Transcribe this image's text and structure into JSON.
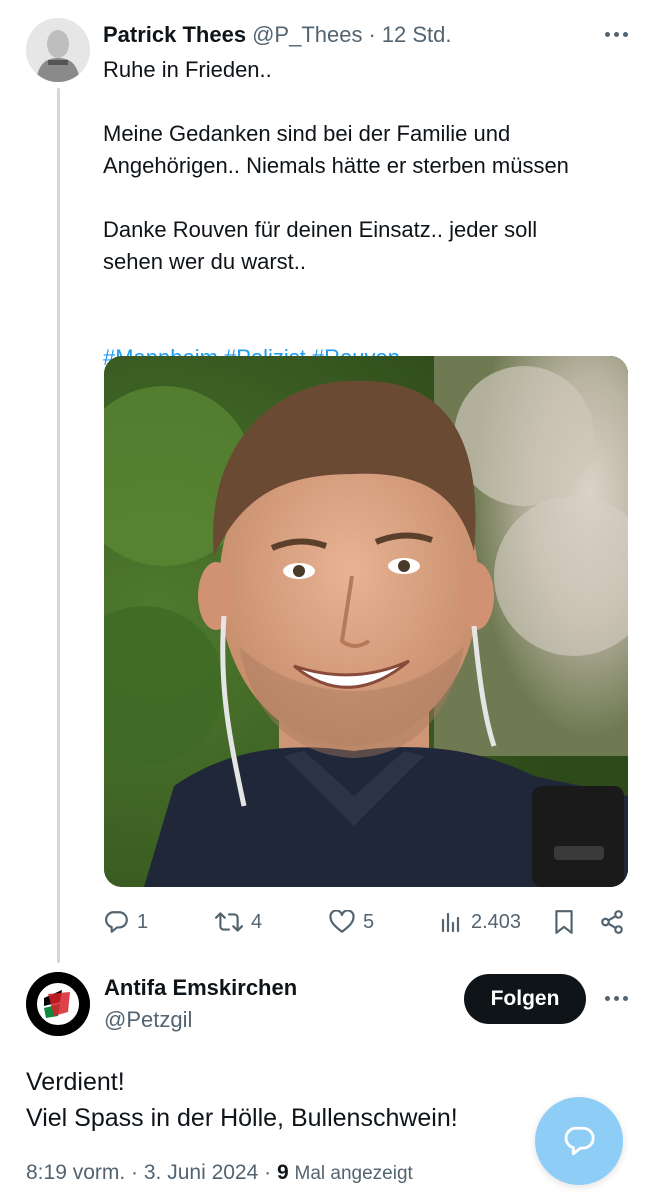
{
  "tweet": {
    "author_name": "Patrick Thees",
    "author_handle": "@P_Thees",
    "separator": "·",
    "time": "12 Std.",
    "line1": "Ruhe in Frieden..",
    "paragraph2": "Meine Gedanken sind bei der Familie und\nAngehörigen.. Niemals hätte er sterben müssen",
    "paragraph3": "Danke Rouven für deinen Einsatz.. jeder soll\nsehen wer du warst..",
    "hashtags": [
      "#Mannheim",
      "#Polizist",
      "#Rouven"
    ],
    "stats": {
      "replies": "1",
      "retweets": "4",
      "likes": "5",
      "views": "2.403"
    }
  },
  "reply": {
    "author_name": "Antifa Emskirchen",
    "author_handle": "@Petzgil",
    "follow_label": "Folgen",
    "text": "Verdient!\nViel Spass in der Hölle, Bullenschwein!",
    "timestamp": "8:19 vorm. · 3. Juni 2024 ·",
    "view_count": "9",
    "view_label": "Mal angezeigt"
  },
  "icons": {
    "more": "more-horizontal-icon",
    "reply": "reply-icon",
    "retweet": "retweet-icon",
    "like": "heart-icon",
    "views": "views-icon",
    "bookmark": "bookmark-icon",
    "share": "share-icon",
    "compose": "compose-reply-icon"
  },
  "colors": {
    "link": "#1d9bf0",
    "secondary": "#536471",
    "primary_text": "#0f1419",
    "fab": "#8ecdf6"
  }
}
